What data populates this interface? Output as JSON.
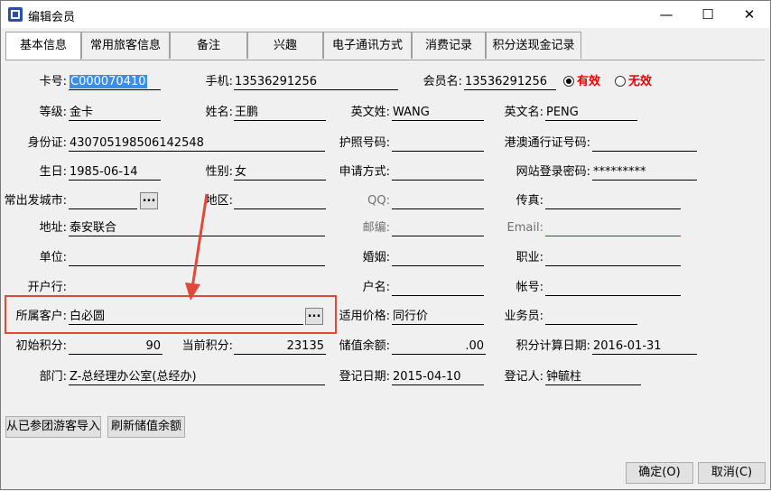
{
  "window": {
    "title": "编辑会员",
    "minimize": "—",
    "maximize": "☐",
    "close": "✕"
  },
  "tabs": [
    "基本信息",
    "常用旅客信息",
    "备注",
    "兴趣",
    "电子通讯方式",
    "消费记录",
    "积分送现金记录"
  ],
  "form": {
    "card_no": {
      "label": "卡号:",
      "value": "C000070410"
    },
    "mobile": {
      "label": "手机:",
      "value": "13536291256"
    },
    "member_name": {
      "label": "会员名:",
      "value": "13536291256"
    },
    "status": {
      "valid": "有效",
      "invalid": "无效",
      "selected": "有效"
    },
    "level": {
      "label": "等级:",
      "value": "金卡"
    },
    "name": {
      "label": "姓名:",
      "value": "王鹏"
    },
    "en_last": {
      "label": "英文姓:",
      "value": "WANG"
    },
    "en_first": {
      "label": "英文名:",
      "value": "PENG"
    },
    "id_card": {
      "label": "身份证:",
      "value": "430705198506142548"
    },
    "passport": {
      "label": "护照号码:",
      "value": ""
    },
    "hk_pass": {
      "label": "港澳通行证号码:",
      "value": ""
    },
    "birthday": {
      "label": "生日:",
      "value": "1985-06-14"
    },
    "gender": {
      "label": "性别:",
      "value": "女"
    },
    "apply_method": {
      "label": "申请方式:",
      "value": ""
    },
    "web_password": {
      "label": "网站登录密码:",
      "value": "*********"
    },
    "depart_city": {
      "label": "常出发城市:",
      "value": "",
      "button": "..."
    },
    "district": {
      "label": "地区:",
      "value": ""
    },
    "qq": {
      "label": "QQ:",
      "value": ""
    },
    "fax": {
      "label": "传真:",
      "value": ""
    },
    "address": {
      "label": "地址:",
      "value": "泰安联合"
    },
    "postcode": {
      "label": "邮编:",
      "value": ""
    },
    "email": {
      "label": "Email:",
      "value": ""
    },
    "company": {
      "label": "单位:",
      "value": ""
    },
    "marriage": {
      "label": "婚姻:",
      "value": ""
    },
    "job": {
      "label": "职业:",
      "value": ""
    },
    "bank": {
      "label": "开户行:",
      "value": ""
    },
    "account_name": {
      "label": "户名:",
      "value": ""
    },
    "account_no": {
      "label": "帐号:",
      "value": ""
    },
    "customer": {
      "label": "所属客户:",
      "value": "白必圆",
      "button": "..."
    },
    "price_type": {
      "label": "适用价格:",
      "value": "同行价"
    },
    "salesman": {
      "label": "业务员:",
      "value": ""
    },
    "initial_points": {
      "label": "初始积分:",
      "value": "90"
    },
    "current_points": {
      "label": "当前积分:",
      "value": "23135"
    },
    "stored_balance": {
      "label": "储值余额:",
      "value": ".00"
    },
    "points_date": {
      "label": "积分计算日期:",
      "value": "2016-01-31"
    },
    "department": {
      "label": "部门:",
      "value": "Z-总经理办公室(总经办)"
    },
    "register_date": {
      "label": "登记日期:",
      "value": "2015-04-10"
    },
    "registrar": {
      "label": "登记人:",
      "value": "钟毓柱"
    }
  },
  "buttons": {
    "import": "从已参团游客导入",
    "refresh": "刷新储值余额",
    "ok": "确定(O)",
    "cancel": "取消(C)"
  },
  "colors": {
    "highlight": "#e04a3a",
    "required": "#e00000",
    "selection": "#3a8ee6"
  }
}
